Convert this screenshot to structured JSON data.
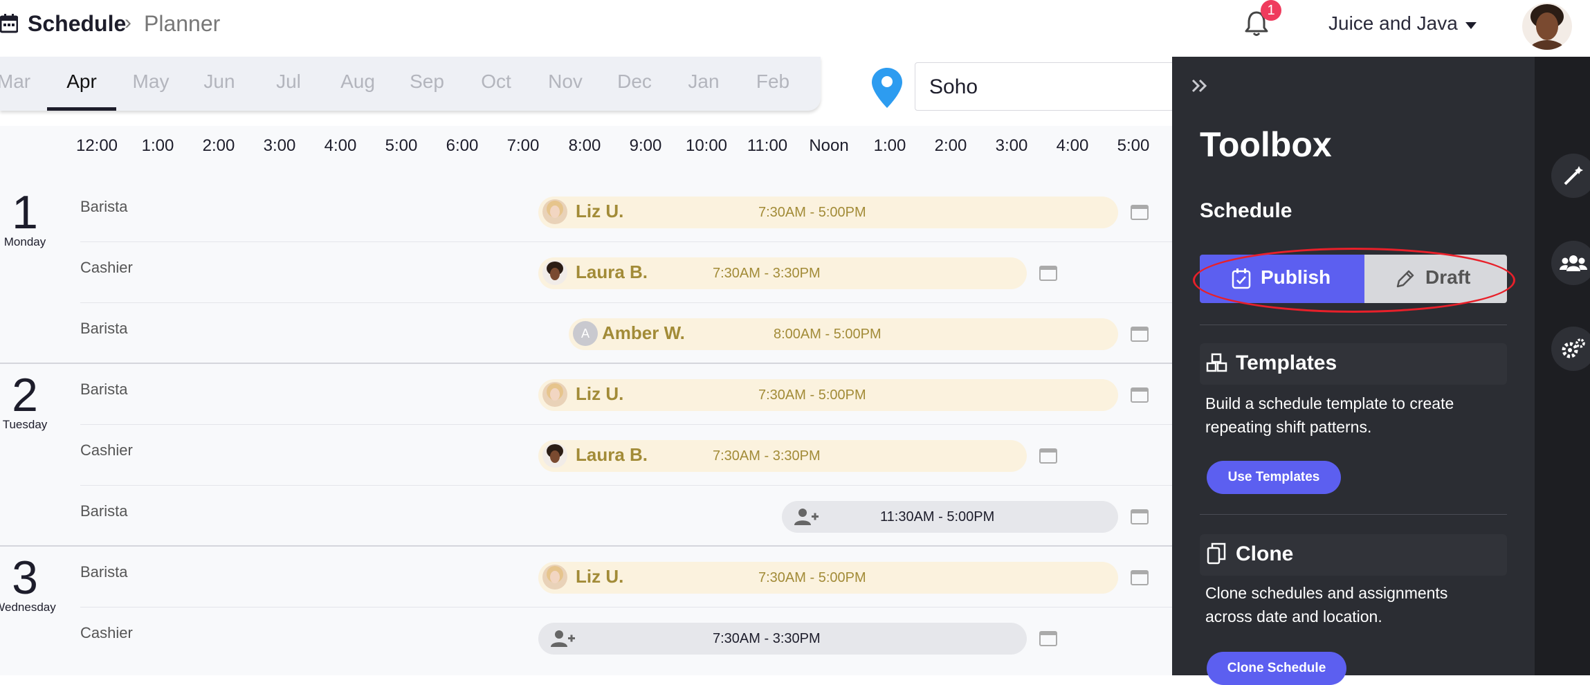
{
  "header": {
    "title": "Schedule",
    "subtitle": "Planner",
    "notification_count": "1",
    "org_name": "Juice and Java"
  },
  "months": [
    "Mar",
    "Apr",
    "May",
    "Jun",
    "Jul",
    "Aug",
    "Sep",
    "Oct",
    "Nov",
    "Dec",
    "Jan",
    "Feb"
  ],
  "active_month": "Apr",
  "location": {
    "value": "Soho"
  },
  "hours": [
    "12:00",
    "1:00",
    "2:00",
    "3:00",
    "4:00",
    "5:00",
    "6:00",
    "7:00",
    "8:00",
    "9:00",
    "10:00",
    "11:00",
    "Noon",
    "1:00",
    "2:00",
    "3:00",
    "4:00",
    "5:00"
  ],
  "days": [
    {
      "num": "1",
      "name": "Monday",
      "shifts": [
        {
          "role": "Barista",
          "name": "Liz U.",
          "time": "7:30AM - 5:00PM"
        },
        {
          "role": "Cashier",
          "name": "Laura B.",
          "time": "7:30AM - 3:30PM"
        },
        {
          "role": "Barista",
          "name": "Amber W.",
          "time": "8:00AM - 5:00PM",
          "initial": "A"
        }
      ]
    },
    {
      "num": "2",
      "name": "Tuesday",
      "shifts": [
        {
          "role": "Barista",
          "name": "Liz U.",
          "time": "7:30AM - 5:00PM"
        },
        {
          "role": "Cashier",
          "name": "Laura B.",
          "time": "7:30AM - 3:30PM"
        },
        {
          "role": "Barista",
          "name": "",
          "time": "11:30AM - 5:00PM"
        }
      ]
    },
    {
      "num": "3",
      "name": "Wednesday",
      "shifts": [
        {
          "role": "Barista",
          "name": "Liz U.",
          "time": "7:30AM - 5:00PM"
        },
        {
          "role": "Cashier",
          "name": "",
          "time": "7:30AM - 3:30PM"
        }
      ]
    }
  ],
  "toolbox": {
    "title": "Toolbox",
    "schedule_heading": "Schedule",
    "publish_label": "Publish",
    "draft_label": "Draft",
    "templates": {
      "title": "Templates",
      "description": "Build a schedule template to create repeating shift patterns.",
      "button": "Use Templates"
    },
    "clone": {
      "title": "Clone",
      "description": "Clone schedules and assignments across date and location.",
      "button": "Clone Schedule"
    }
  },
  "colors": {
    "accent": "#5c5ff0",
    "shift_fill": "#fbf2de",
    "shift_text": "#a28b37",
    "panel": "#2b2d33",
    "badge": "#ef3b5d",
    "highlight": "#e8202a"
  }
}
